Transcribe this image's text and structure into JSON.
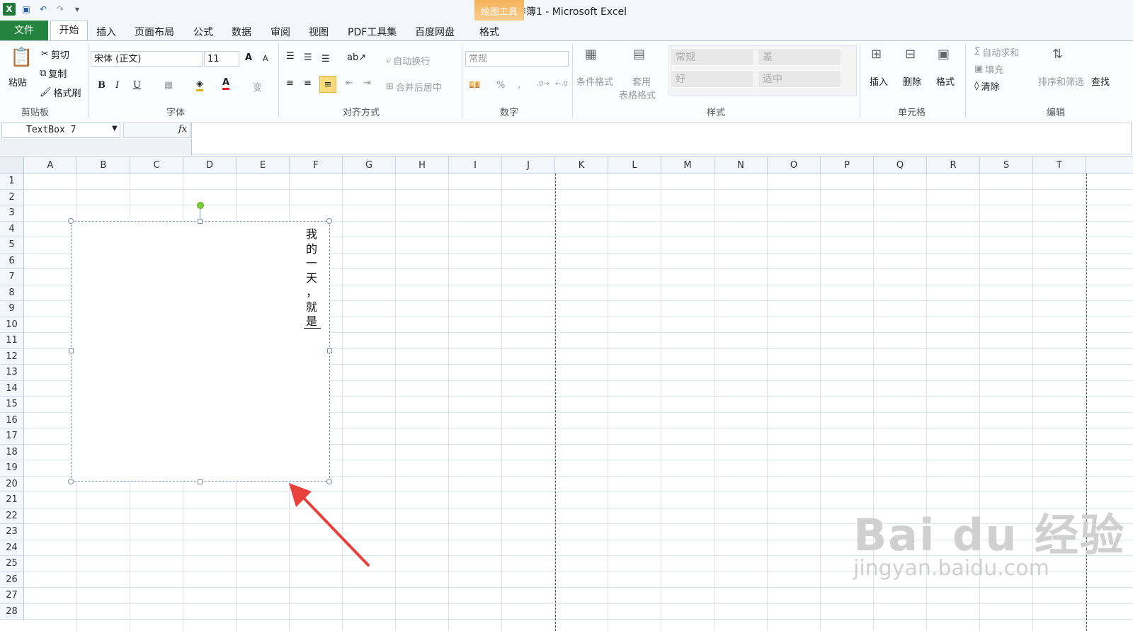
{
  "window": {
    "title": "工作簿1 - Microsoft Excel"
  },
  "contextual_tab": {
    "group": "绘图工具",
    "tab": "格式"
  },
  "tabs": [
    "文件",
    "开始",
    "插入",
    "页面布局",
    "公式",
    "数据",
    "审阅",
    "视图",
    "PDF工具集",
    "百度网盘",
    "格式"
  ],
  "ribbon": {
    "clipboard": {
      "paste": "粘贴",
      "cut": "剪切",
      "copy": "复制",
      "format_painter": "格式刷",
      "label": "剪贴板"
    },
    "font": {
      "name": "宋体 (正文)",
      "size": "11",
      "bold": "B",
      "italic": "I",
      "underline": "U",
      "label": "字体",
      "grow": "A",
      "shrink": "A",
      "font_color": "A",
      "phonetic": "变"
    },
    "alignment": {
      "wrap": "自动换行",
      "merge": "合并后居中",
      "label": "对齐方式"
    },
    "number": {
      "format": "常规",
      "percent": "%",
      "comma": ",",
      "label": "数字"
    },
    "styles": {
      "conditional": "条件格式",
      "table_line1": "套用",
      "table_line2": "表格格式",
      "normal": "常规",
      "bad": "差",
      "good": "好",
      "neutral": "适中",
      "label": "样式"
    },
    "cells": {
      "insert": "插入",
      "delete": "删除",
      "format": "格式",
      "label": "单元格"
    },
    "editing": {
      "autosum": "自动求和",
      "fill": "填充",
      "clear": "清除",
      "sort": "排序和筛选",
      "find": "查找",
      "label": "编辑"
    }
  },
  "formula_bar": {
    "name_box": "TextBox 7",
    "fx": "fx"
  },
  "grid": {
    "columns": [
      "A",
      "B",
      "C",
      "D",
      "E",
      "F",
      "G",
      "H",
      "I",
      "J",
      "K",
      "L",
      "M",
      "N",
      "O",
      "P",
      "Q",
      "R",
      "S",
      "T"
    ],
    "rows": [
      "1",
      "2",
      "3",
      "4",
      "5",
      "6",
      "7",
      "8",
      "9",
      "10",
      "11",
      "12",
      "13",
      "14",
      "15",
      "16",
      "17",
      "18",
      "19",
      "20",
      "21",
      "22",
      "23",
      "24",
      "25",
      "26",
      "27",
      "28"
    ]
  },
  "textbox": {
    "chars": [
      "我",
      "的",
      "一",
      "天",
      "，",
      "就",
      "是"
    ]
  },
  "watermark": {
    "brand": "Bai du 经验",
    "url": "jingyan.baidu.com"
  },
  "colors": {
    "file_tab": "#23843f",
    "contextual": "#f6b25a",
    "arrow": "#e8403a",
    "rotation_handle": "#7ccc3c"
  }
}
